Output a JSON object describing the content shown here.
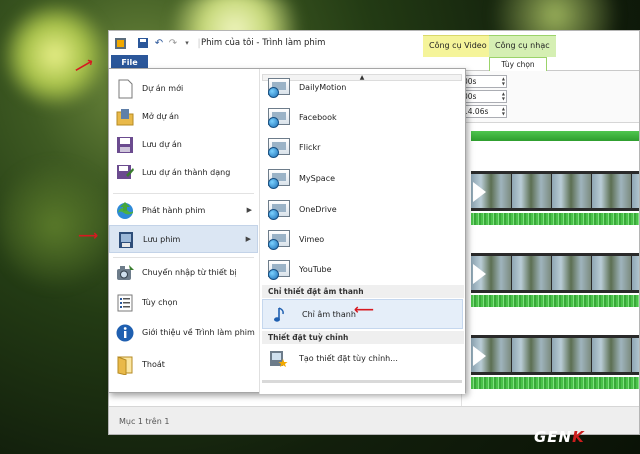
{
  "window": {
    "title": "Phim của tôi - Trình làm phim",
    "context_tabs": [
      "Công cụ Video",
      "Công cụ nhạc"
    ],
    "active_subtab": "Tùy chọn",
    "file_tab": "File",
    "spin_values": [
      "00s",
      "00s",
      "14.06s"
    ]
  },
  "file_menu": {
    "left_items": [
      {
        "label": "Dự án mới",
        "icon": "new-project-icon"
      },
      {
        "label": "Mở dự án",
        "icon": "open-project-icon"
      },
      {
        "label": "Lưu dự án",
        "icon": "save-project-icon"
      },
      {
        "label": "Lưu dự án thành dạng",
        "icon": "save-as-icon"
      },
      {
        "label": "Phát hành phim",
        "icon": "publish-globe-icon",
        "has_submenu": true
      },
      {
        "label": "Lưu phim",
        "icon": "save-movie-icon",
        "has_submenu": true,
        "selected": true
      },
      {
        "label": "Chuyển nhập từ thiết bị",
        "icon": "import-camera-icon"
      },
      {
        "label": "Tùy chọn",
        "icon": "options-icon"
      },
      {
        "label": "Giới thiệu về Trình làm phim",
        "icon": "info-icon"
      },
      {
        "label": "Thoát",
        "icon": "exit-icon"
      }
    ],
    "submenu_items": [
      {
        "label": "DailyMotion"
      },
      {
        "label": "Facebook"
      },
      {
        "label": "Flickr"
      },
      {
        "label": "MySpace"
      },
      {
        "label": "OneDrive"
      },
      {
        "label": "Vimeo"
      },
      {
        "label": "YouTube"
      }
    ],
    "section_audio": "Chỉ thiết đặt âm thanh",
    "audio_only": "Chỉ âm thanh",
    "section_custom": "Thiết đặt tuỳ chỉnh",
    "custom_create": "Tạo thiết đặt tùy chỉnh..."
  },
  "status": {
    "text": "Mục 1 trên 1"
  },
  "watermark": {
    "logo": "GENK"
  },
  "colors": {
    "file_tab": "#2b579a",
    "video_tools": "#f5f49a",
    "music_tools": "#d5efb3",
    "annotation_arrow": "#d71920",
    "highlight": "#dbe6f3"
  }
}
